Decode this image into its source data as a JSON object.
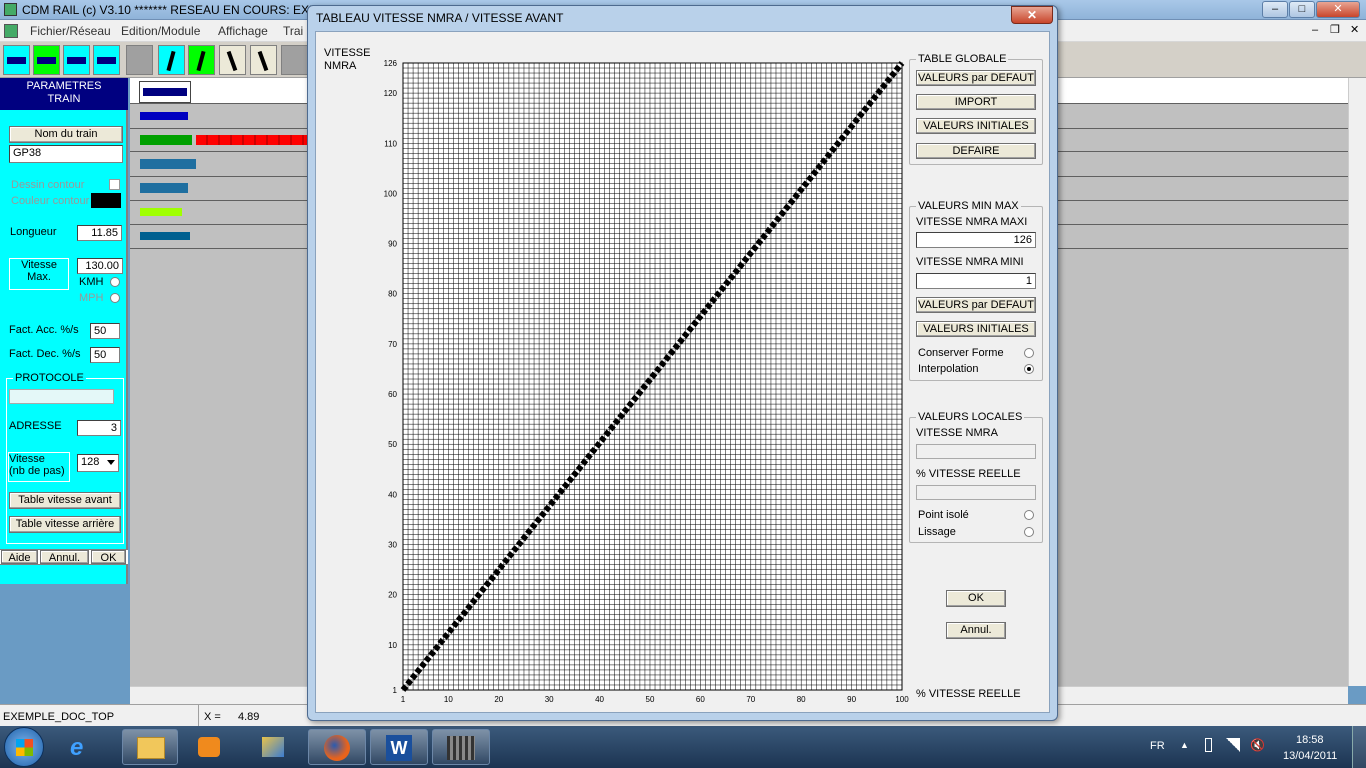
{
  "main_window": {
    "title": "CDM RAIL (c) V3.10     ******* RESEAU EN COURS: EXE",
    "controls": {
      "minimize": "–",
      "maximize": "□",
      "close": "✕",
      "restore": "❐"
    }
  },
  "menubar": {
    "items": [
      "Fichier/Réseau",
      "Edition/Module",
      "Affichage",
      "Trai"
    ]
  },
  "toolbar": {
    "buttons": [
      "train-tool-1",
      "train-tool-2",
      "train-tool-3",
      "train-tool-4",
      "blank-tool",
      "switch-tool-1",
      "switch-tool-2",
      "switch-tool-3",
      "switch-tool-4",
      "blank-tool-2"
    ]
  },
  "left_panel": {
    "title_line1": "PARAMETRES",
    "title_line2": "TRAIN",
    "name_button": "Nom du train",
    "name_value": "GP38",
    "outline_drawing_label": "Dessin contour",
    "outline_color_label": "Couleur contour",
    "length_label": "Longueur",
    "length_value": "11.85",
    "max_speed_label_1": "Vitesse",
    "max_speed_label_2": "Max.",
    "max_speed_value": "130.00",
    "kmh_label": "KMH",
    "mph_label": "MPH",
    "acc_label": "Fact. Acc. %/s",
    "acc_value": "50",
    "dec_label": "Fact. Dec. %/s",
    "dec_value": "50",
    "protocol_label": "PROTOCOLE",
    "address_label": "ADRESSE",
    "address_value": "3",
    "speed_steps_label_1": "Vitesse",
    "speed_steps_label_2": "(nb de pas)",
    "speed_steps_value": "128",
    "forward_table_button": "Table vitesse avant",
    "reverse_table_button": "Table vitesse arrière",
    "help_button": "Aide",
    "cancel_button": "Annul.",
    "ok_button": "OK"
  },
  "statusbar": {
    "file": "EXEMPLE_DOC_TOP",
    "x_label": "X =",
    "x_value": "4.89"
  },
  "taskbar": {
    "language": "FR",
    "time": "18:58",
    "date": "13/04/2011",
    "apps": [
      "explorer",
      "media-player",
      "paint",
      "firefox",
      "word",
      "cdm-rail"
    ]
  },
  "dialog": {
    "title": "TABLEAU VITESSE NMRA / VITESSE AVANT",
    "close": "✕",
    "y_axis_label_1": "VITESSE",
    "y_axis_label_2": "NMRA",
    "x_axis_label": "% VITESSE REELLE",
    "global_table": {
      "title": "TABLE GLOBALE",
      "default_button": "VALEURS par DEFAUT",
      "import_button": "IMPORT",
      "initial_button": "VALEURS INITIALES",
      "undo_button": "DEFAIRE"
    },
    "minmax": {
      "title": "VALEURS MIN MAX",
      "max_label": "VITESSE NMRA MAXI",
      "max_value": "126",
      "min_label": "VITESSE NMRA MINI",
      "min_value": "1",
      "default_button": "VALEURS par DEFAUT",
      "initial_button": "VALEURS INITIALES",
      "keep_shape_label": "Conserver Forme",
      "interpolation_label": "Interpolation"
    },
    "local": {
      "title": "VALEURS LOCALES",
      "nmra_label": "VITESSE NMRA",
      "real_label": "% VITESSE REELLE",
      "isolated_label": "Point isolé",
      "smoothing_label": "Lissage"
    },
    "ok_button": "OK",
    "cancel_button": "Annul."
  },
  "chart_data": {
    "type": "scatter",
    "xlabel": "% VITESSE REELLE",
    "ylabel": "VITESSE NMRA",
    "xlim": [
      1,
      100
    ],
    "ylim": [
      1,
      126
    ],
    "x_ticks": [
      1,
      10,
      20,
      30,
      40,
      50,
      60,
      70,
      80,
      90,
      100
    ],
    "y_ticks": [
      1,
      10,
      20,
      30,
      40,
      50,
      60,
      70,
      80,
      90,
      100,
      110,
      120,
      126
    ],
    "grid": true,
    "series": [
      {
        "line": {
          "from": [
            1,
            1
          ],
          "to": [
            100,
            126
          ]
        },
        "color": "#000000"
      }
    ]
  }
}
